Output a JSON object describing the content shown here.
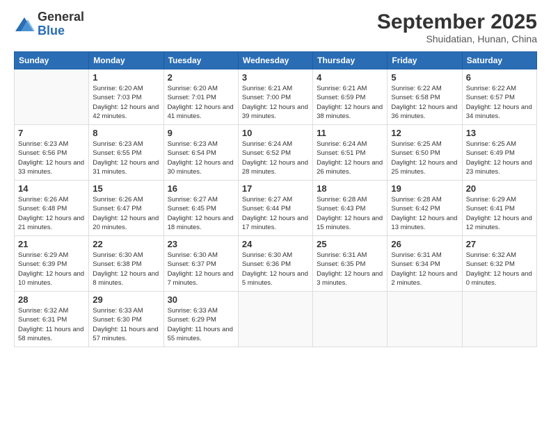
{
  "logo": {
    "general": "General",
    "blue": "Blue"
  },
  "title": "September 2025",
  "location": "Shuidatian, Hunan, China",
  "headers": [
    "Sunday",
    "Monday",
    "Tuesday",
    "Wednesday",
    "Thursday",
    "Friday",
    "Saturday"
  ],
  "weeks": [
    [
      {
        "day": "",
        "sunrise": "",
        "sunset": "",
        "daylight": ""
      },
      {
        "day": "1",
        "sunrise": "Sunrise: 6:20 AM",
        "sunset": "Sunset: 7:03 PM",
        "daylight": "Daylight: 12 hours and 42 minutes."
      },
      {
        "day": "2",
        "sunrise": "Sunrise: 6:20 AM",
        "sunset": "Sunset: 7:01 PM",
        "daylight": "Daylight: 12 hours and 41 minutes."
      },
      {
        "day": "3",
        "sunrise": "Sunrise: 6:21 AM",
        "sunset": "Sunset: 7:00 PM",
        "daylight": "Daylight: 12 hours and 39 minutes."
      },
      {
        "day": "4",
        "sunrise": "Sunrise: 6:21 AM",
        "sunset": "Sunset: 6:59 PM",
        "daylight": "Daylight: 12 hours and 38 minutes."
      },
      {
        "day": "5",
        "sunrise": "Sunrise: 6:22 AM",
        "sunset": "Sunset: 6:58 PM",
        "daylight": "Daylight: 12 hours and 36 minutes."
      },
      {
        "day": "6",
        "sunrise": "Sunrise: 6:22 AM",
        "sunset": "Sunset: 6:57 PM",
        "daylight": "Daylight: 12 hours and 34 minutes."
      }
    ],
    [
      {
        "day": "7",
        "sunrise": "Sunrise: 6:23 AM",
        "sunset": "Sunset: 6:56 PM",
        "daylight": "Daylight: 12 hours and 33 minutes."
      },
      {
        "day": "8",
        "sunrise": "Sunrise: 6:23 AM",
        "sunset": "Sunset: 6:55 PM",
        "daylight": "Daylight: 12 hours and 31 minutes."
      },
      {
        "day": "9",
        "sunrise": "Sunrise: 6:23 AM",
        "sunset": "Sunset: 6:54 PM",
        "daylight": "Daylight: 12 hours and 30 minutes."
      },
      {
        "day": "10",
        "sunrise": "Sunrise: 6:24 AM",
        "sunset": "Sunset: 6:52 PM",
        "daylight": "Daylight: 12 hours and 28 minutes."
      },
      {
        "day": "11",
        "sunrise": "Sunrise: 6:24 AM",
        "sunset": "Sunset: 6:51 PM",
        "daylight": "Daylight: 12 hours and 26 minutes."
      },
      {
        "day": "12",
        "sunrise": "Sunrise: 6:25 AM",
        "sunset": "Sunset: 6:50 PM",
        "daylight": "Daylight: 12 hours and 25 minutes."
      },
      {
        "day": "13",
        "sunrise": "Sunrise: 6:25 AM",
        "sunset": "Sunset: 6:49 PM",
        "daylight": "Daylight: 12 hours and 23 minutes."
      }
    ],
    [
      {
        "day": "14",
        "sunrise": "Sunrise: 6:26 AM",
        "sunset": "Sunset: 6:48 PM",
        "daylight": "Daylight: 12 hours and 21 minutes."
      },
      {
        "day": "15",
        "sunrise": "Sunrise: 6:26 AM",
        "sunset": "Sunset: 6:47 PM",
        "daylight": "Daylight: 12 hours and 20 minutes."
      },
      {
        "day": "16",
        "sunrise": "Sunrise: 6:27 AM",
        "sunset": "Sunset: 6:45 PM",
        "daylight": "Daylight: 12 hours and 18 minutes."
      },
      {
        "day": "17",
        "sunrise": "Sunrise: 6:27 AM",
        "sunset": "Sunset: 6:44 PM",
        "daylight": "Daylight: 12 hours and 17 minutes."
      },
      {
        "day": "18",
        "sunrise": "Sunrise: 6:28 AM",
        "sunset": "Sunset: 6:43 PM",
        "daylight": "Daylight: 12 hours and 15 minutes."
      },
      {
        "day": "19",
        "sunrise": "Sunrise: 6:28 AM",
        "sunset": "Sunset: 6:42 PM",
        "daylight": "Daylight: 12 hours and 13 minutes."
      },
      {
        "day": "20",
        "sunrise": "Sunrise: 6:29 AM",
        "sunset": "Sunset: 6:41 PM",
        "daylight": "Daylight: 12 hours and 12 minutes."
      }
    ],
    [
      {
        "day": "21",
        "sunrise": "Sunrise: 6:29 AM",
        "sunset": "Sunset: 6:39 PM",
        "daylight": "Daylight: 12 hours and 10 minutes."
      },
      {
        "day": "22",
        "sunrise": "Sunrise: 6:30 AM",
        "sunset": "Sunset: 6:38 PM",
        "daylight": "Daylight: 12 hours and 8 minutes."
      },
      {
        "day": "23",
        "sunrise": "Sunrise: 6:30 AM",
        "sunset": "Sunset: 6:37 PM",
        "daylight": "Daylight: 12 hours and 7 minutes."
      },
      {
        "day": "24",
        "sunrise": "Sunrise: 6:30 AM",
        "sunset": "Sunset: 6:36 PM",
        "daylight": "Daylight: 12 hours and 5 minutes."
      },
      {
        "day": "25",
        "sunrise": "Sunrise: 6:31 AM",
        "sunset": "Sunset: 6:35 PM",
        "daylight": "Daylight: 12 hours and 3 minutes."
      },
      {
        "day": "26",
        "sunrise": "Sunrise: 6:31 AM",
        "sunset": "Sunset: 6:34 PM",
        "daylight": "Daylight: 12 hours and 2 minutes."
      },
      {
        "day": "27",
        "sunrise": "Sunrise: 6:32 AM",
        "sunset": "Sunset: 6:32 PM",
        "daylight": "Daylight: 12 hours and 0 minutes."
      }
    ],
    [
      {
        "day": "28",
        "sunrise": "Sunrise: 6:32 AM",
        "sunset": "Sunset: 6:31 PM",
        "daylight": "Daylight: 11 hours and 58 minutes."
      },
      {
        "day": "29",
        "sunrise": "Sunrise: 6:33 AM",
        "sunset": "Sunset: 6:30 PM",
        "daylight": "Daylight: 11 hours and 57 minutes."
      },
      {
        "day": "30",
        "sunrise": "Sunrise: 6:33 AM",
        "sunset": "Sunset: 6:29 PM",
        "daylight": "Daylight: 11 hours and 55 minutes."
      },
      {
        "day": "",
        "sunrise": "",
        "sunset": "",
        "daylight": ""
      },
      {
        "day": "",
        "sunrise": "",
        "sunset": "",
        "daylight": ""
      },
      {
        "day": "",
        "sunrise": "",
        "sunset": "",
        "daylight": ""
      },
      {
        "day": "",
        "sunrise": "",
        "sunset": "",
        "daylight": ""
      }
    ]
  ]
}
